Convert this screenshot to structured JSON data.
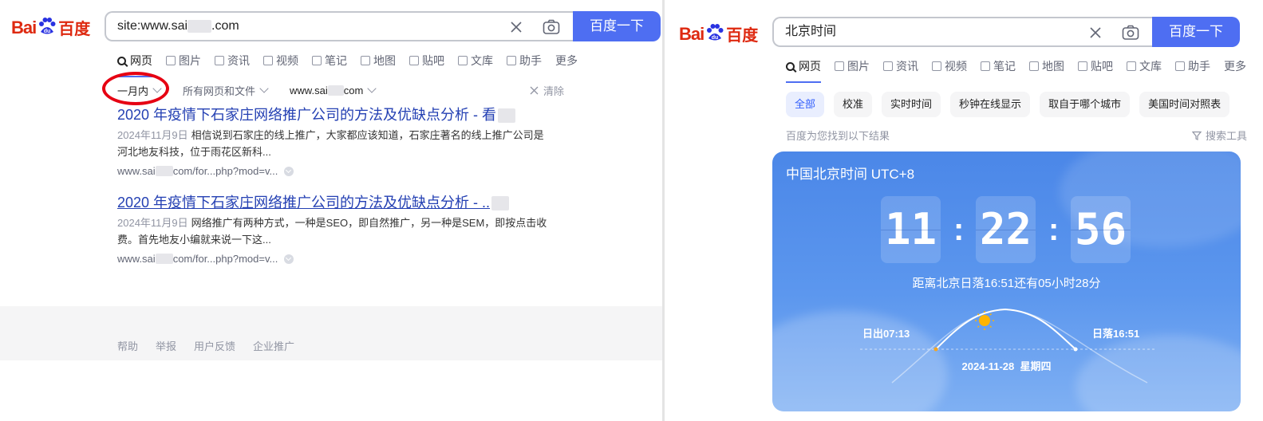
{
  "left": {
    "logo": {
      "part1": "Bai",
      "part2": "百度",
      "paw_text": "du"
    },
    "search": {
      "query": "site:www.sai",
      "query_tail": ".com",
      "button": "百度一下"
    },
    "tabs": [
      {
        "label": "网页",
        "icon": "search-icon"
      },
      {
        "label": "图片",
        "icon": "image-icon"
      },
      {
        "label": "资讯",
        "icon": "news-icon"
      },
      {
        "label": "视频",
        "icon": "video-icon"
      },
      {
        "label": "笔记",
        "icon": "note-icon"
      },
      {
        "label": "地图",
        "icon": "map-icon"
      },
      {
        "label": "贴吧",
        "icon": "tieba-icon"
      },
      {
        "label": "文库",
        "icon": "wenku-icon"
      },
      {
        "label": "助手",
        "icon": "ai-icon"
      },
      {
        "label": "更多",
        "icon": ""
      }
    ],
    "filters": {
      "time": "一月内",
      "type": "所有网页和文件",
      "site_prefix": "www.sai",
      "site_suffix": "com",
      "clear": "清除"
    },
    "results": [
      {
        "title": "2020 年疫情下石家庄网络推广公司的方法及优缺点分析 - 看",
        "date": "2024年11月9日",
        "desc": "相信说到石家庄的线上推广，大家都应该知道，石家庄著名的线上推广公司是河北地友科技，位于雨花区新科...",
        "url_prefix": "www.sai",
        "url_suffix": "com/for...php?mod=v..."
      },
      {
        "title": "2020 年疫情下石家庄网络推广公司的方法及优缺点分析 - ..",
        "date": "2024年11月9日",
        "desc": "网络推广有两种方式，一种是SEO，即自然推广，另一种是SEM，即按点击收费。首先地友小编就来说一下这...",
        "url_prefix": "www.sai",
        "url_suffix": "com/for...php?mod=v..."
      }
    ],
    "footer": [
      "帮助",
      "举报",
      "用户反馈",
      "企业推广"
    ],
    "highlight_color": "#e60012"
  },
  "right": {
    "logo": {
      "part1": "Bai",
      "part2": "百度",
      "paw_text": "du"
    },
    "search": {
      "query": "北京时间",
      "button": "百度一下"
    },
    "tabs": [
      {
        "label": "网页",
        "icon": "search-icon"
      },
      {
        "label": "图片",
        "icon": "image-icon"
      },
      {
        "label": "资讯",
        "icon": "news-icon"
      },
      {
        "label": "视频",
        "icon": "video-icon"
      },
      {
        "label": "笔记",
        "icon": "note-icon"
      },
      {
        "label": "地图",
        "icon": "map-icon"
      },
      {
        "label": "贴吧",
        "icon": "tieba-icon"
      },
      {
        "label": "文库",
        "icon": "wenku-icon"
      },
      {
        "label": "助手",
        "icon": "ai-icon"
      },
      {
        "label": "更多",
        "icon": ""
      }
    ],
    "pills": [
      "全部",
      "校准",
      "实时时间",
      "秒钟在线显示",
      "取自于哪个城市",
      "美国时间对照表"
    ],
    "found_text": "百度为您找到以下结果",
    "tools_label": "搜索工具",
    "time_card": {
      "title": "中国北京时间 UTC+8",
      "hours": "11",
      "minutes": "22",
      "seconds": "56",
      "countdown": "距离北京日落16:51还有05小时28分",
      "sunrise": "日出07:13",
      "sunset": "日落16:51",
      "date": "2024-11-28",
      "weekday": "星期四"
    }
  },
  "colors": {
    "brand_blue": "#4e6ef2",
    "link_blue": "#2440b3",
    "brand_red": "#de2910"
  }
}
